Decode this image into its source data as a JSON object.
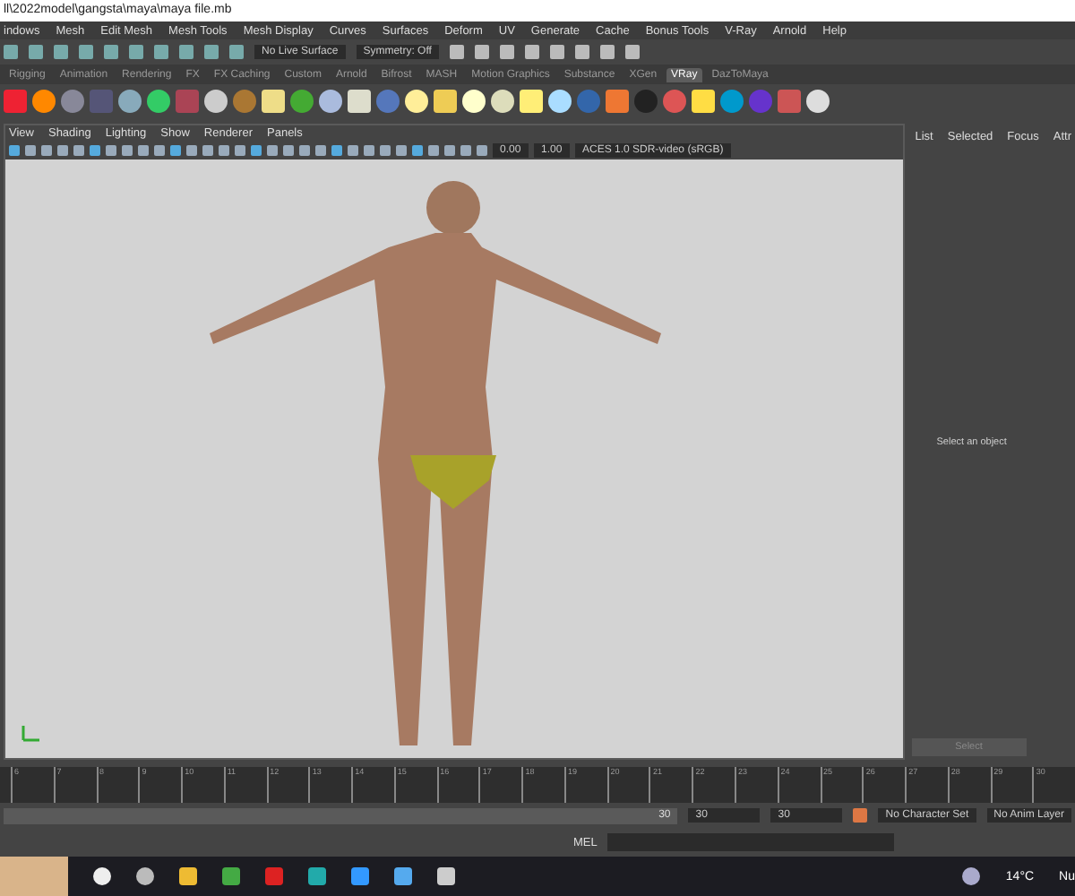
{
  "window": {
    "title": "ll\\2022model\\gangsta\\maya\\maya file.mb"
  },
  "menu": [
    "indows",
    "Mesh",
    "Edit Mesh",
    "Mesh Tools",
    "Mesh Display",
    "Curves",
    "Surfaces",
    "Deform",
    "UV",
    "Generate",
    "Cache",
    "Bonus Tools",
    "V-Ray",
    "Arnold",
    "Help"
  ],
  "status_line": {
    "live_surface": "No Live Surface",
    "symmetry": "Symmetry: Off"
  },
  "shelf_tabs": [
    {
      "label": "Rigging",
      "selected": false
    },
    {
      "label": "Animation",
      "selected": false
    },
    {
      "label": "Rendering",
      "selected": false
    },
    {
      "label": "FX",
      "selected": false
    },
    {
      "label": "FX Caching",
      "selected": false
    },
    {
      "label": "Custom",
      "selected": false
    },
    {
      "label": "Arnold",
      "selected": false
    },
    {
      "label": "Bifrost",
      "selected": false
    },
    {
      "label": "MASH",
      "selected": false
    },
    {
      "label": "Motion Graphics",
      "selected": false
    },
    {
      "label": "Substance",
      "selected": false
    },
    {
      "label": "XGen",
      "selected": false
    },
    {
      "label": "VRay",
      "selected": true
    },
    {
      "label": "DazToMaya",
      "selected": false
    }
  ],
  "viewport": {
    "menu": [
      "View",
      "Shading",
      "Lighting",
      "Show",
      "Renderer",
      "Panels"
    ],
    "exposure": "0.00",
    "gamma": "1.00",
    "color_space": "ACES 1.0 SDR-video (sRGB)"
  },
  "attribute_panel": {
    "tabs": [
      "List",
      "Selected",
      "Focus",
      "Attr"
    ],
    "message": "Select an object",
    "button": "Select"
  },
  "timeline": {
    "ticks": [
      "6",
      "7",
      "8",
      "9",
      "10",
      "11",
      "12",
      "13",
      "14",
      "15",
      "16",
      "17",
      "18",
      "19",
      "20",
      "21",
      "22",
      "23",
      "24",
      "25",
      "26",
      "27",
      "28",
      "29",
      "30"
    ]
  },
  "range": {
    "level": 1,
    "slider_end": "30",
    "end": "30",
    "playback_end": "30",
    "character_set": "No Character Set",
    "anim_layer": "No Anim Layer"
  },
  "command_line": {
    "language": "MEL"
  },
  "taskbar": {
    "temperature": "14°C",
    "tray_text": "Nu"
  }
}
